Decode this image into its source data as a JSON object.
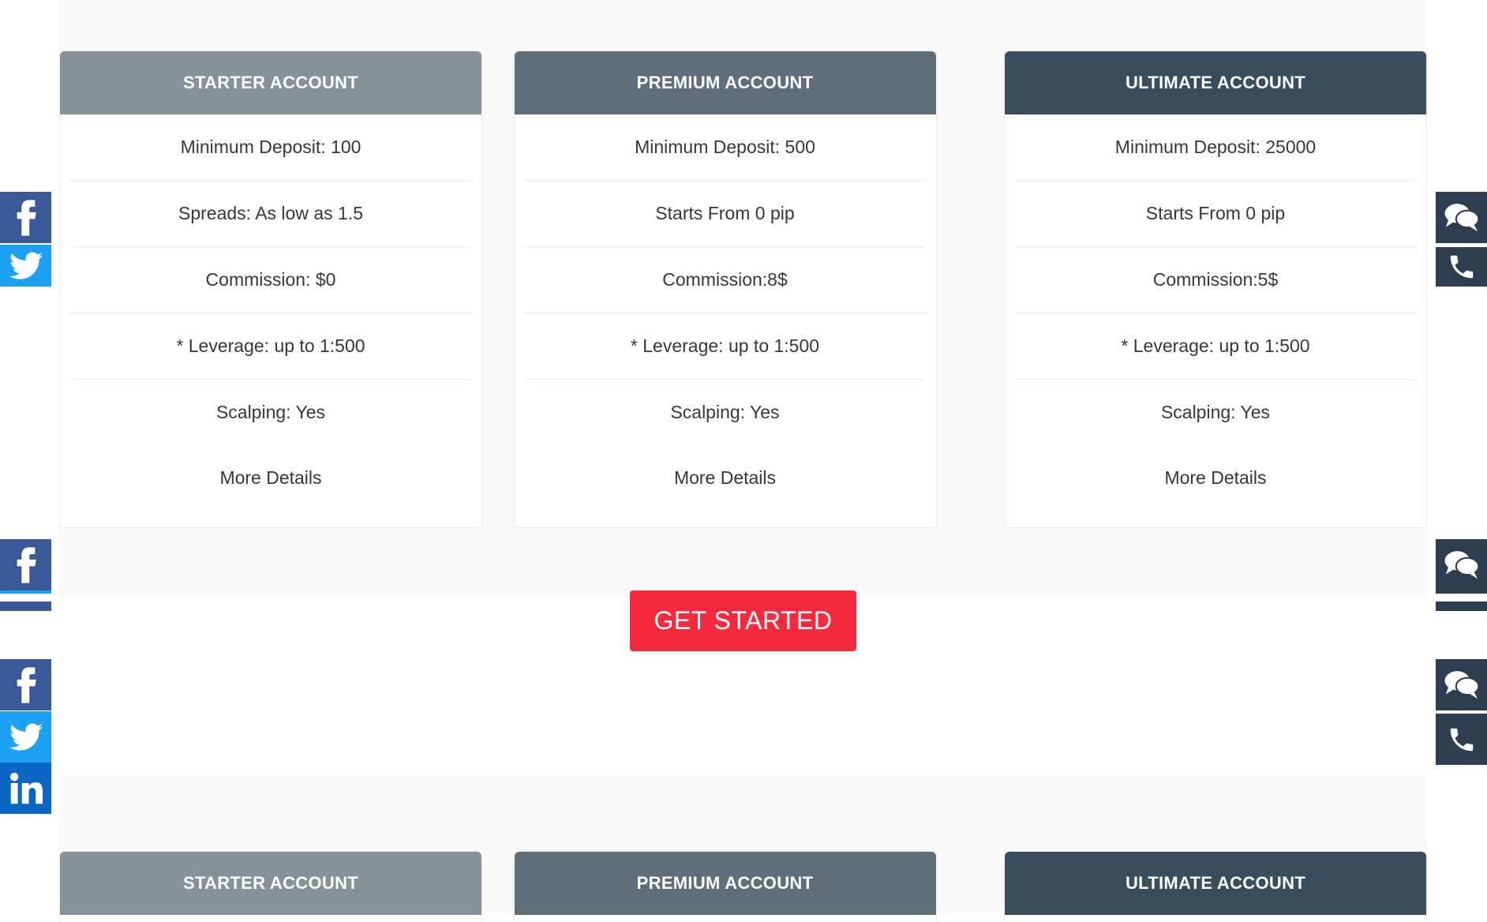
{
  "plans": [
    {
      "name": "STARTER ACCOUNT",
      "features": [
        "Minimum Deposit: 100",
        "Spreads: As low as 1.5",
        "Commission: $0",
        "* Leverage: up to 1:500",
        "Scalping: Yes"
      ],
      "more": "More Details"
    },
    {
      "name": "PREMIUM ACCOUNT",
      "features": [
        "Minimum Deposit: 500",
        "Starts From 0 pip",
        "Commission:8$",
        "* Leverage: up to 1:500",
        "Scalping: Yes"
      ],
      "more": "More Details"
    },
    {
      "name": "ULTIMATE ACCOUNT",
      "features": [
        "Minimum Deposit: 25000",
        "Starts From 0 pip",
        "Commission:5$",
        "* Leverage: up to 1:500",
        "Scalping: Yes"
      ],
      "more": "More Details"
    }
  ],
  "cta_label": "GET STARTED",
  "colors": {
    "starter_header": "#879298",
    "premium_header": "#5f6e78",
    "ultimate_header": "#384e5c",
    "cta": "#f52a3f",
    "facebook": "#3b5998",
    "twitter": "#1da1f2",
    "linkedin": "#0a66c2",
    "contact": "#2c3e50"
  },
  "icons": {
    "left_share": [
      "facebook-icon",
      "twitter-icon",
      "linkedin-icon"
    ],
    "right_contact": [
      "chat-icon",
      "phone-icon"
    ]
  }
}
